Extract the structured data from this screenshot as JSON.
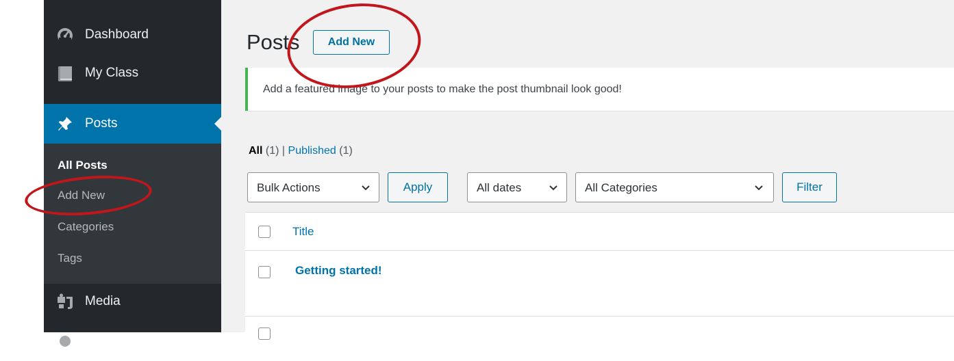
{
  "sidebar": {
    "items": [
      {
        "label": "Dashboard",
        "icon": "dashboard-icon"
      },
      {
        "label": "My Class",
        "icon": "book-icon"
      },
      {
        "label": "Posts",
        "icon": "pushpin-icon",
        "active": true
      },
      {
        "label": "Media",
        "icon": "media-icon"
      }
    ],
    "submenu": [
      "All Posts",
      "Add New",
      "Categories",
      "Tags"
    ],
    "active_submenu": "All Posts",
    "colors": {
      "background": "#23282d",
      "active": "#0073aa",
      "submenu_bg": "#32373c"
    }
  },
  "page": {
    "title": "Posts",
    "add_new_label": "Add New"
  },
  "notice": {
    "text": "Add a featured image to your posts to make the post thumbnail look good!",
    "border_color": "#46b450"
  },
  "filters": {
    "all_label": "All",
    "all_count": "(1)",
    "separator": "|",
    "published_label": "Published",
    "published_count": "(1)"
  },
  "toolbar": {
    "bulk_actions": "Bulk Actions",
    "apply": "Apply",
    "dates": "All dates",
    "categories": "All Categories",
    "filter": "Filter"
  },
  "table": {
    "column_title": "Title",
    "rows": [
      {
        "title": "Getting started!"
      }
    ]
  },
  "annotations": {
    "color": "#c0161c",
    "highlighted": [
      "Add New",
      "Add New"
    ]
  }
}
